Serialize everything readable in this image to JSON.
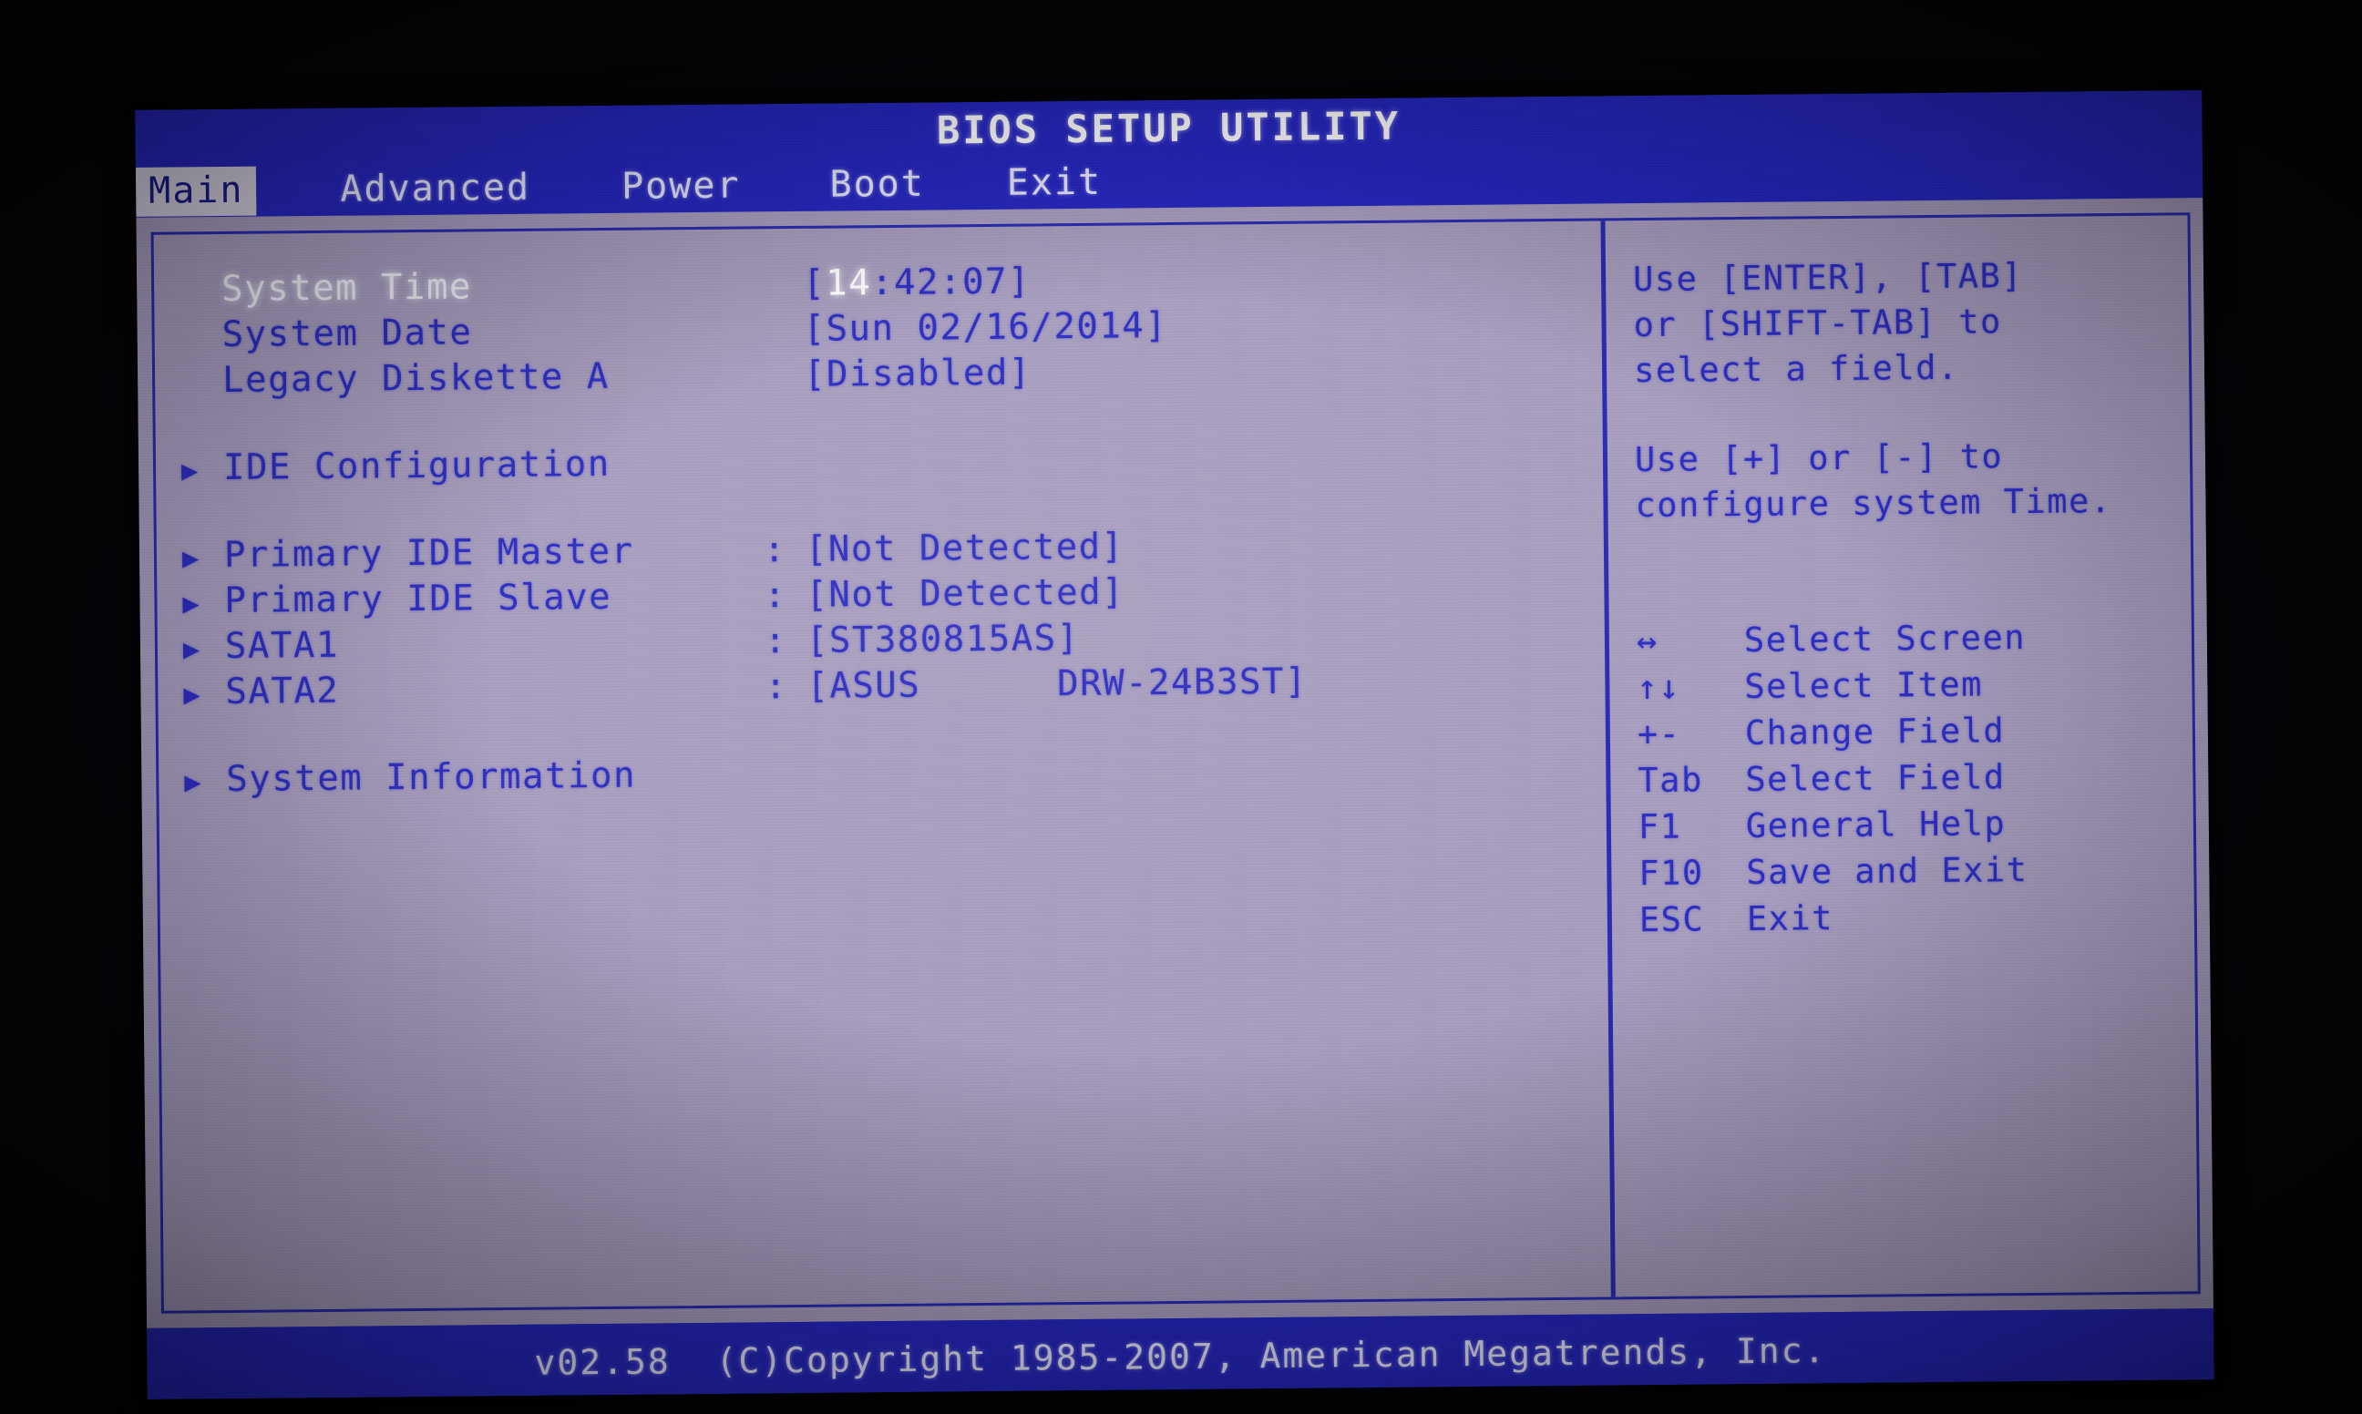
{
  "window": {
    "title": "BIOS SETUP UTILITY"
  },
  "tabs": [
    {
      "label": "Main",
      "active": true
    },
    {
      "label": "Advanced",
      "active": false
    },
    {
      "label": "Power",
      "active": false
    },
    {
      "label": "Boot",
      "active": false
    },
    {
      "label": "Exit",
      "active": false
    }
  ],
  "main": {
    "rows": [
      {
        "bullet": "",
        "label": "System Time",
        "colon": "",
        "value_prefix": "[",
        "value_hl": "14",
        "value_suffix": ":42:07]",
        "selected": true,
        "gap": false
      },
      {
        "bullet": "",
        "label": "System Date",
        "colon": "",
        "value": "[Sun 02/16/2014]",
        "selected": false,
        "gap": false
      },
      {
        "bullet": "",
        "label": "Legacy Diskette A",
        "colon": "",
        "value": "[Disabled]",
        "selected": false,
        "gap": false
      },
      {
        "bullet": "▶",
        "label": "IDE Configuration",
        "colon": "",
        "value": "",
        "selected": false,
        "gap": true
      },
      {
        "bullet": "▶",
        "label": "Primary IDE Master",
        "colon": ":",
        "value": "[Not Detected]",
        "selected": false,
        "gap": true
      },
      {
        "bullet": "▶",
        "label": "Primary IDE Slave",
        "colon": ":",
        "value": "[Not Detected]",
        "selected": false,
        "gap": false
      },
      {
        "bullet": "▶",
        "label": "SATA1",
        "colon": ":",
        "value": "[ST380815AS]",
        "selected": false,
        "gap": false
      },
      {
        "bullet": "▶",
        "label": "SATA2",
        "colon": ":",
        "value": "[ASUS      DRW-24B3ST]",
        "selected": false,
        "gap": false
      },
      {
        "bullet": "▶",
        "label": "System Information",
        "colon": "",
        "value": "",
        "selected": false,
        "gap": true
      }
    ]
  },
  "help": {
    "blocks": [
      "Use [ENTER], [TAB]\nor [SHIFT-TAB] to\nselect a field.",
      "Use [+] or [-] to\nconfigure system Time."
    ],
    "legend": [
      {
        "key": "↔",
        "desc": "Select Screen"
      },
      {
        "key": "↑↓",
        "desc": "Select Item"
      },
      {
        "key": "+-",
        "desc": "Change Field"
      },
      {
        "key": "Tab",
        "desc": "Select Field"
      },
      {
        "key": "F1",
        "desc": "General Help"
      },
      {
        "key": "F10",
        "desc": "Save and Exit"
      },
      {
        "key": "ESC",
        "desc": "Exit"
      }
    ]
  },
  "footer": {
    "copyright": "v02.58  (C)Copyright 1985-2007, American Megatrends, Inc."
  },
  "colors": {
    "bios_blue": "#2626c2",
    "panel_bg": "#a79dbe",
    "text_blue": "#2d2dc0",
    "highlight": "#ffffff",
    "active_tab_bg": "#d6d2e2"
  }
}
